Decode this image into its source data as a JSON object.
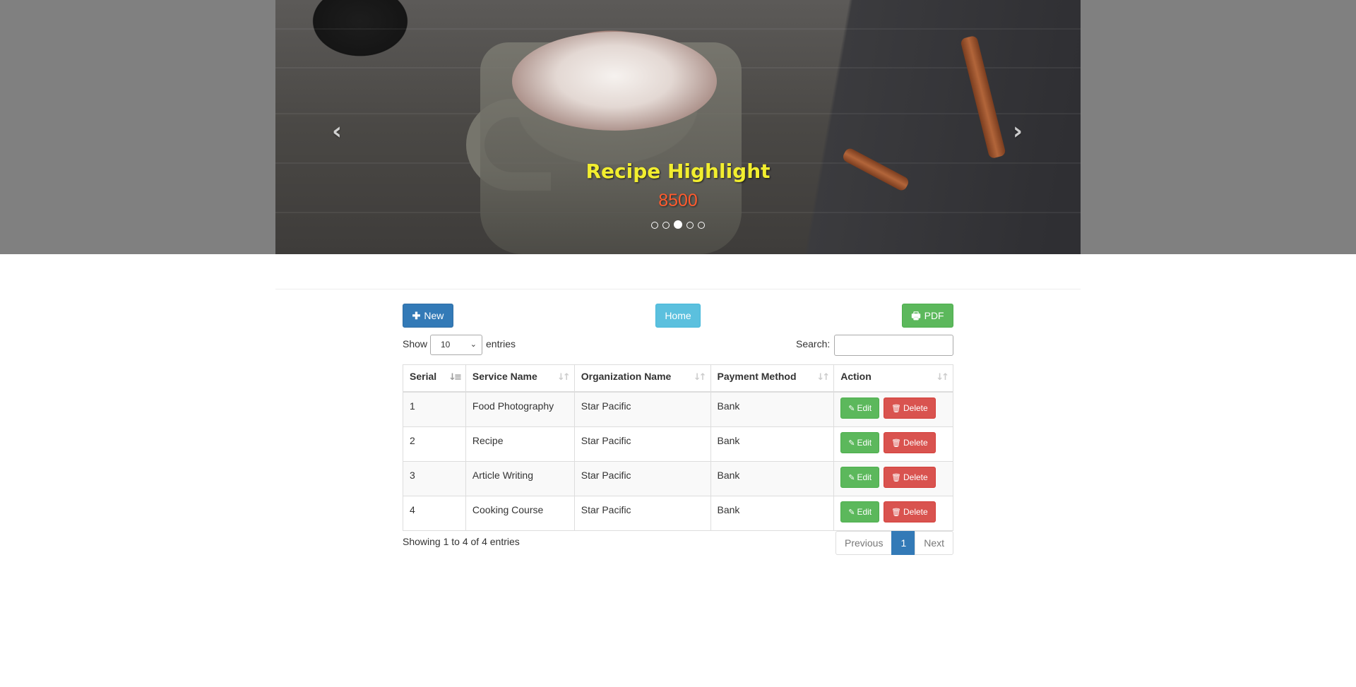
{
  "carousel": {
    "caption_title": "Recipe Highlight",
    "caption_price": "8500",
    "prev_glyph": "‹",
    "next_glyph": "›",
    "slide_count": 5,
    "active_slide": 3
  },
  "toolbar": {
    "new_icon": "✚",
    "new_label": "New",
    "home_label": "Home",
    "pdf_icon": "🖶",
    "pdf_label": "PDF"
  },
  "length_menu": {
    "show_label": "Show",
    "selected": "10",
    "entries_label": "entries"
  },
  "search": {
    "label": "Search:",
    "value": ""
  },
  "table": {
    "columns": [
      "Serial",
      "Service Name",
      "Organization Name",
      "Payment Method",
      "Action"
    ],
    "rows": [
      {
        "serial": "1",
        "service": "Food Photography",
        "organization": "Star Pacific",
        "payment": "Bank"
      },
      {
        "serial": "2",
        "service": "Recipe",
        "organization": "Star Pacific",
        "payment": "Bank"
      },
      {
        "serial": "3",
        "service": "Article Writing",
        "organization": "Star Pacific",
        "payment": "Bank"
      },
      {
        "serial": "4",
        "service": "Cooking Course",
        "organization": "Star Pacific",
        "payment": "Bank"
      }
    ],
    "edit_label": "Edit",
    "delete_label": "Delete"
  },
  "footer": {
    "info": "Showing 1 to 4 of 4 entries",
    "previous_label": "Previous",
    "current_page": "1",
    "next_label": "Next"
  },
  "colors": {
    "primary": "#337ab7",
    "info": "#5bc0de",
    "success": "#5cb85c",
    "danger": "#d9534f",
    "caption_title": "#f2ee2f",
    "caption_price": "#ff5b2e"
  }
}
